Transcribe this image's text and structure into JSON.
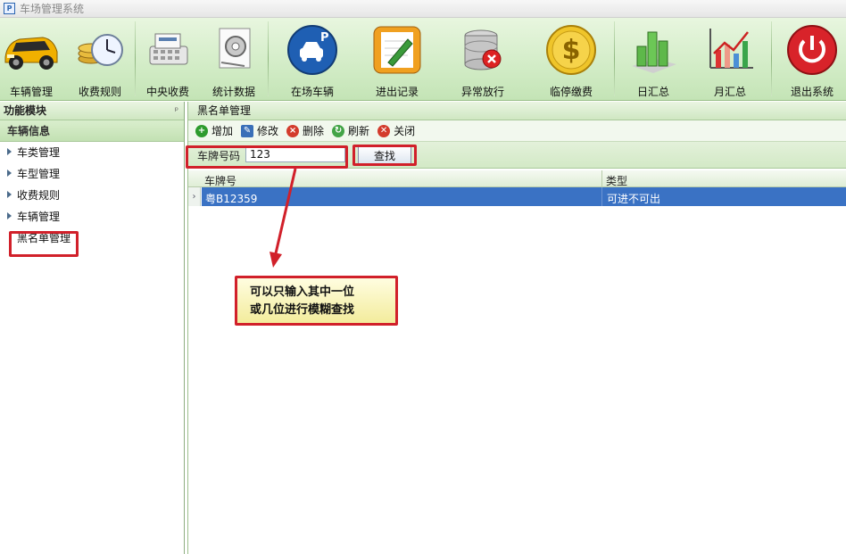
{
  "window": {
    "title": "车场管理系统",
    "icon": "app-logo-icon"
  },
  "toolbar": {
    "items": [
      {
        "label": "车辆管理",
        "icon": "car-icon"
      },
      {
        "label": "收费规则",
        "icon": "coins-clock-icon"
      },
      {
        "label": "中央收费",
        "icon": "cash-register-icon"
      },
      {
        "label": "统计数据",
        "icon": "gear-document-icon"
      },
      {
        "label": "在场车辆",
        "icon": "parking-icon"
      },
      {
        "label": "进出记录",
        "icon": "edit-note-icon"
      },
      {
        "label": "异常放行",
        "icon": "database-error-icon"
      },
      {
        "label": "临停缴费",
        "icon": "dollar-coin-icon"
      },
      {
        "label": "日汇总",
        "icon": "bar-chart-icon"
      },
      {
        "label": "月汇总",
        "icon": "line-chart-icon"
      },
      {
        "label": "退出系统",
        "icon": "power-icon"
      }
    ]
  },
  "sidebar": {
    "header": "功能模块",
    "pin": "ᵖ",
    "section": "车辆信息",
    "items": [
      {
        "label": "车类管理"
      },
      {
        "label": "车型管理"
      },
      {
        "label": "收费规则"
      },
      {
        "label": "车辆管理"
      },
      {
        "label": "黑名单管理"
      }
    ]
  },
  "main": {
    "tab_title": "黑名单管理",
    "actions": [
      {
        "label": "增加",
        "icon": "add-icon",
        "color": "#2e9b2e"
      },
      {
        "label": "修改",
        "icon": "edit-icon",
        "color": "#3a6fb8"
      },
      {
        "label": "删除",
        "icon": "delete-icon",
        "color": "#d33b2c"
      },
      {
        "label": "刷新",
        "icon": "refresh-icon",
        "color": "#43a447"
      },
      {
        "label": "关闭",
        "icon": "close-icon",
        "color": "#d33b2c"
      }
    ],
    "search": {
      "label": "车牌号码",
      "value": "123",
      "button": "查找"
    },
    "table": {
      "columns": [
        "车牌号",
        "类型"
      ],
      "rows": [
        [
          "粤B12359",
          "可进不可出"
        ]
      ],
      "row_marker": "›"
    },
    "callout": {
      "line1": "可以只输入其中一位",
      "line2": "或几位进行模糊查找"
    }
  },
  "colors": {
    "annotation_red": "#d1202a",
    "selected_row": "#3a72c4",
    "toolbar_green": "#d2ecc6"
  }
}
